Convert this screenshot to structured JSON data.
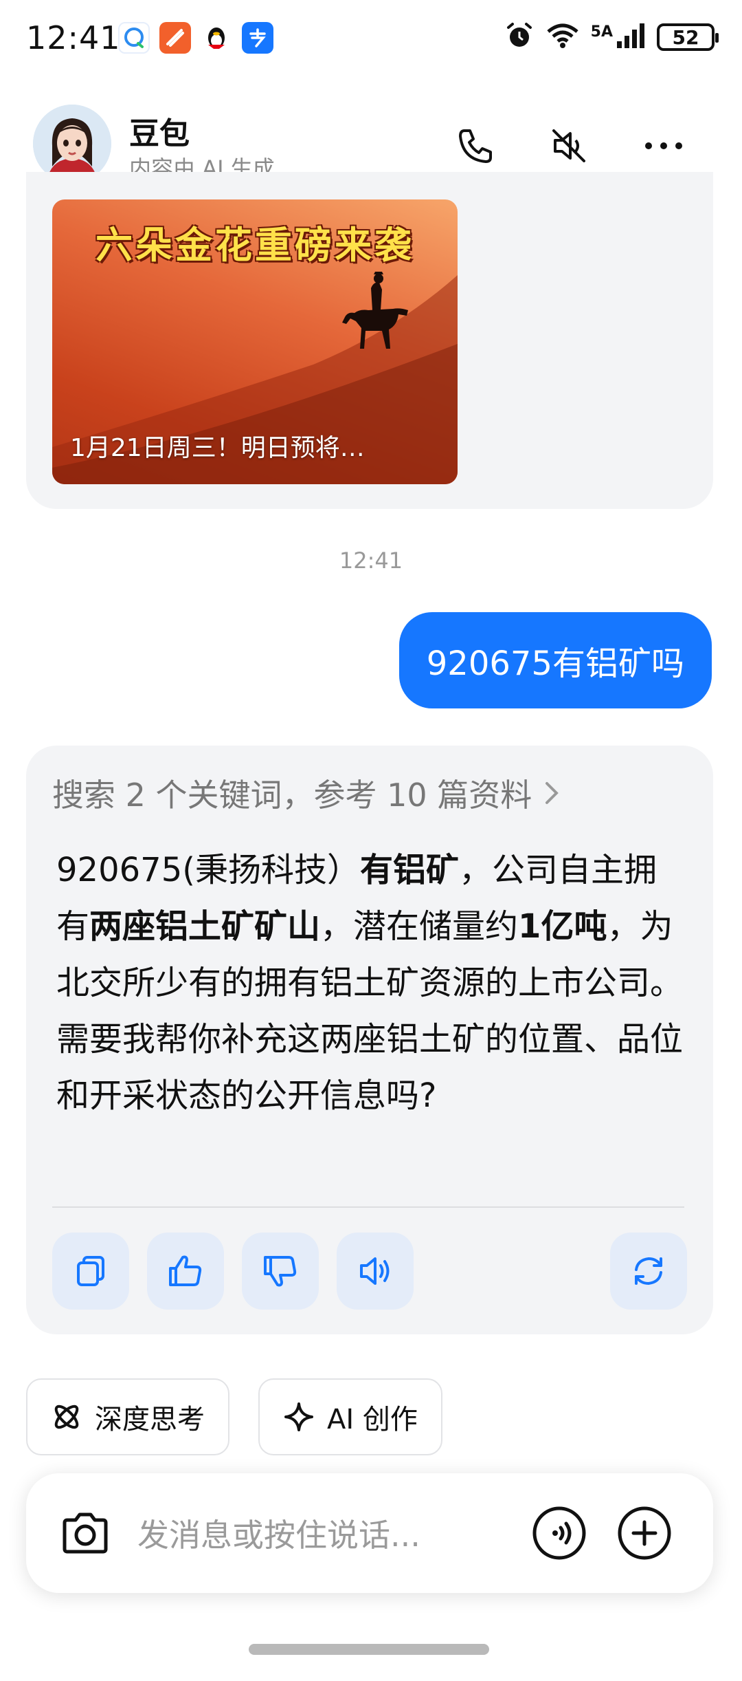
{
  "status_bar": {
    "time": "12:41",
    "network_label": "5A",
    "battery": "52",
    "notification_icons": [
      "chat-bubble-icon",
      "feishu-icon",
      "penguin-icon",
      "alipay-icon"
    ],
    "system_icons": [
      "alarm-icon",
      "wifi-icon",
      "signal-icon",
      "battery-icon"
    ]
  },
  "header": {
    "name": "豆包",
    "subtitle": "内容由 AI 生成",
    "buttons": [
      "phone-icon",
      "mute-icon",
      "more-icon"
    ]
  },
  "promo_card": {
    "title": "六朵金花重磅来袭",
    "caption": "1月21日周三！明日预将…"
  },
  "timestamp": "12:41",
  "user_message": "920675有铝矿吗",
  "reply": {
    "search_summary": "搜索 2 个关键词，参考 10 篇资料",
    "paragraph": [
      {
        "text": "920675(秉扬科技）",
        "bold": false
      },
      {
        "text": "有铝矿",
        "bold": true
      },
      {
        "text": "，公司自主拥有",
        "bold": false
      },
      {
        "text": "两座铝土矿矿山",
        "bold": true
      },
      {
        "text": "，潜在储量约",
        "bold": false
      },
      {
        "text": "1亿吨",
        "bold": true
      },
      {
        "text": "，为北交所少有的拥有铝土矿资源的上市公司。",
        "bold": false
      }
    ],
    "followup": "需要我帮你补充这两座铝土矿的位置、品位和开采状态的公开信息吗?",
    "actions": [
      "copy-icon",
      "thumbs-up-icon",
      "thumbs-down-icon",
      "speaker-icon",
      "refresh-icon"
    ]
  },
  "chips": [
    {
      "icon": "atom-icon",
      "label": "深度思考"
    },
    {
      "icon": "sparkle-icon",
      "label": "AI 创作"
    }
  ],
  "input": {
    "placeholder": "发消息或按住说话..."
  },
  "colors": {
    "accent": "#1677ff",
    "card_bg": "#f3f4f6",
    "action_bg": "#e4ecf9"
  }
}
